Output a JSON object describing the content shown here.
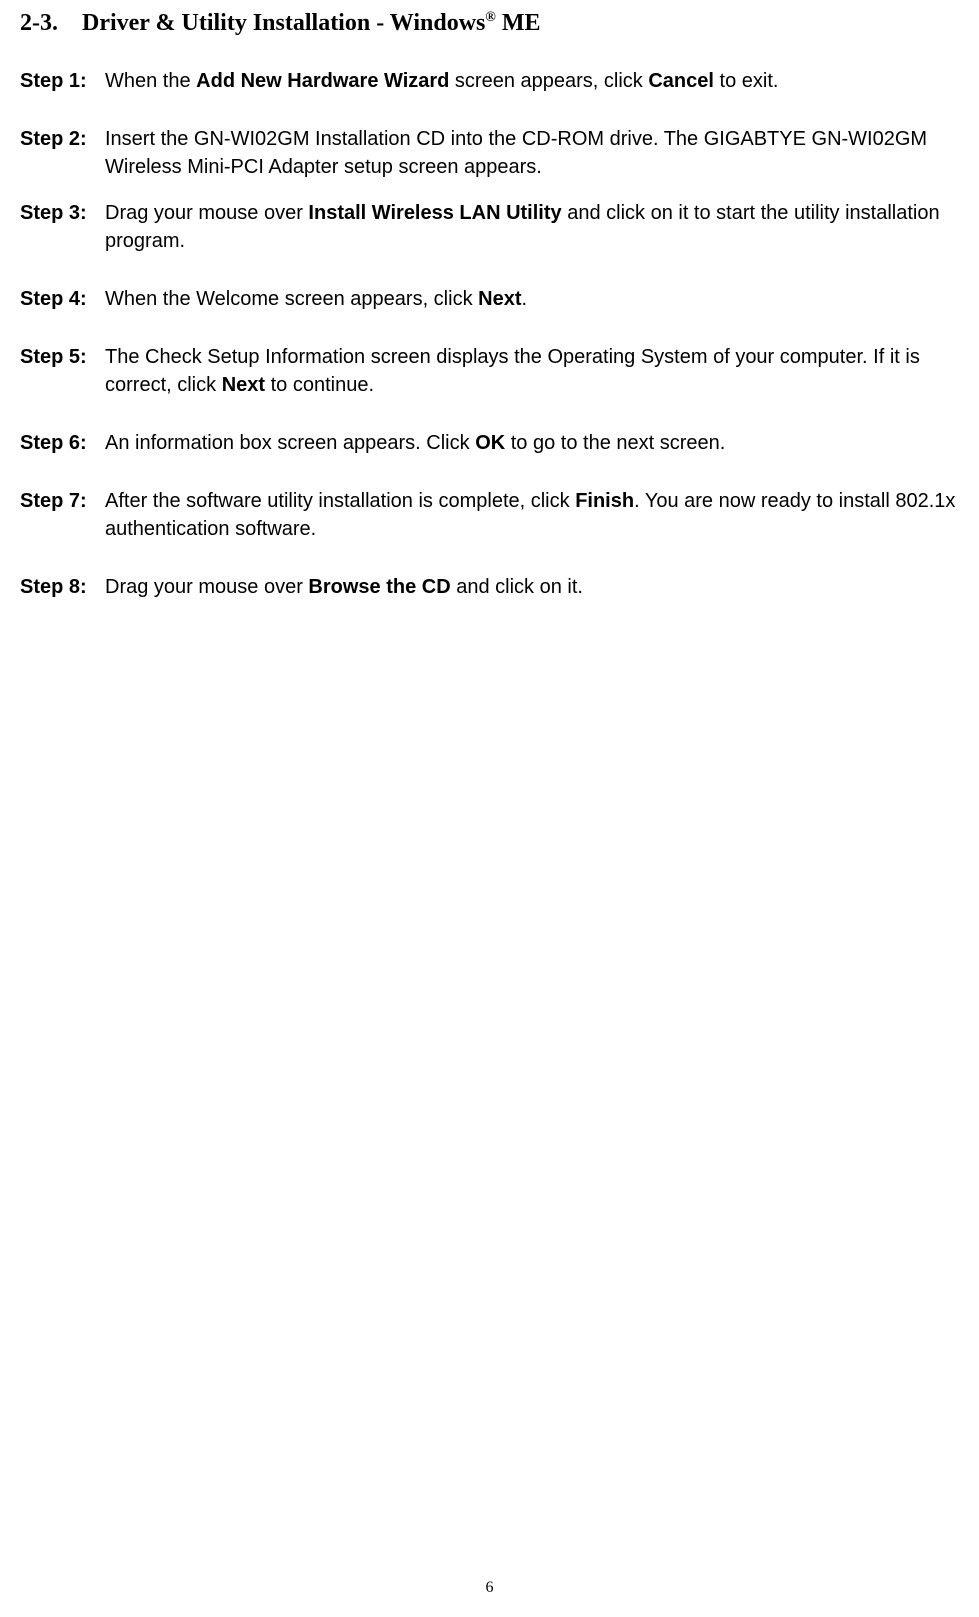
{
  "heading": {
    "section": "2-3.",
    "title_before": "Driver & Utility Installation - Windows",
    "sup": "®",
    "title_after": " ME"
  },
  "steps": [
    {
      "label": "Step 1:",
      "segments": [
        {
          "text": "When the ",
          "bold": false
        },
        {
          "text": "Add New Hardware Wizard",
          "bold": true
        },
        {
          "text": " screen appears, click ",
          "bold": false
        },
        {
          "text": "Cancel",
          "bold": true
        },
        {
          "text": " to exit.",
          "bold": false
        }
      ]
    },
    {
      "label": "Step 2:",
      "segments": [
        {
          "text": "Insert the GN-WI02GM Installation CD into the CD-ROM drive. The GIGABTYE GN-WI02GM Wireless Mini-PCI Adapter setup screen appears.",
          "bold": false
        }
      ]
    },
    {
      "label": "Step 3:",
      "segments": [
        {
          "text": "Drag your mouse over ",
          "bold": false
        },
        {
          "text": "Install Wireless LAN Utility",
          "bold": true
        },
        {
          "text": " and click on it to start the utility installation program.",
          "bold": false
        }
      ]
    },
    {
      "label": "Step 4:",
      "segments": [
        {
          "text": "When the Welcome screen appears, click ",
          "bold": false
        },
        {
          "text": "Next",
          "bold": true
        },
        {
          "text": ".",
          "bold": false
        }
      ]
    },
    {
      "label": "Step 5:",
      "segments": [
        {
          "text": "The Check Setup Information screen displays the Operating System of your computer. If it is correct, click ",
          "bold": false
        },
        {
          "text": "Next",
          "bold": true
        },
        {
          "text": " to continue.",
          "bold": false
        }
      ]
    },
    {
      "label": "Step 6:",
      "segments": [
        {
          "text": "An information box screen appears. Click ",
          "bold": false
        },
        {
          "text": "OK",
          "bold": true
        },
        {
          "text": " to go to the next screen.",
          "bold": false
        }
      ]
    },
    {
      "label": "Step 7:",
      "segments": [
        {
          "text": "After the software utility installation is complete, click ",
          "bold": false
        },
        {
          "text": "Finish",
          "bold": true
        },
        {
          "text": ".   You are now ready to install 802.1x authentication software.",
          "bold": false
        }
      ]
    },
    {
      "label": "Step 8:",
      "segments": [
        {
          "text": "Drag your mouse over ",
          "bold": false
        },
        {
          "text": "Browse the CD",
          "bold": true
        },
        {
          "text": " and click on it.",
          "bold": false
        }
      ]
    }
  ],
  "page_number": "6"
}
